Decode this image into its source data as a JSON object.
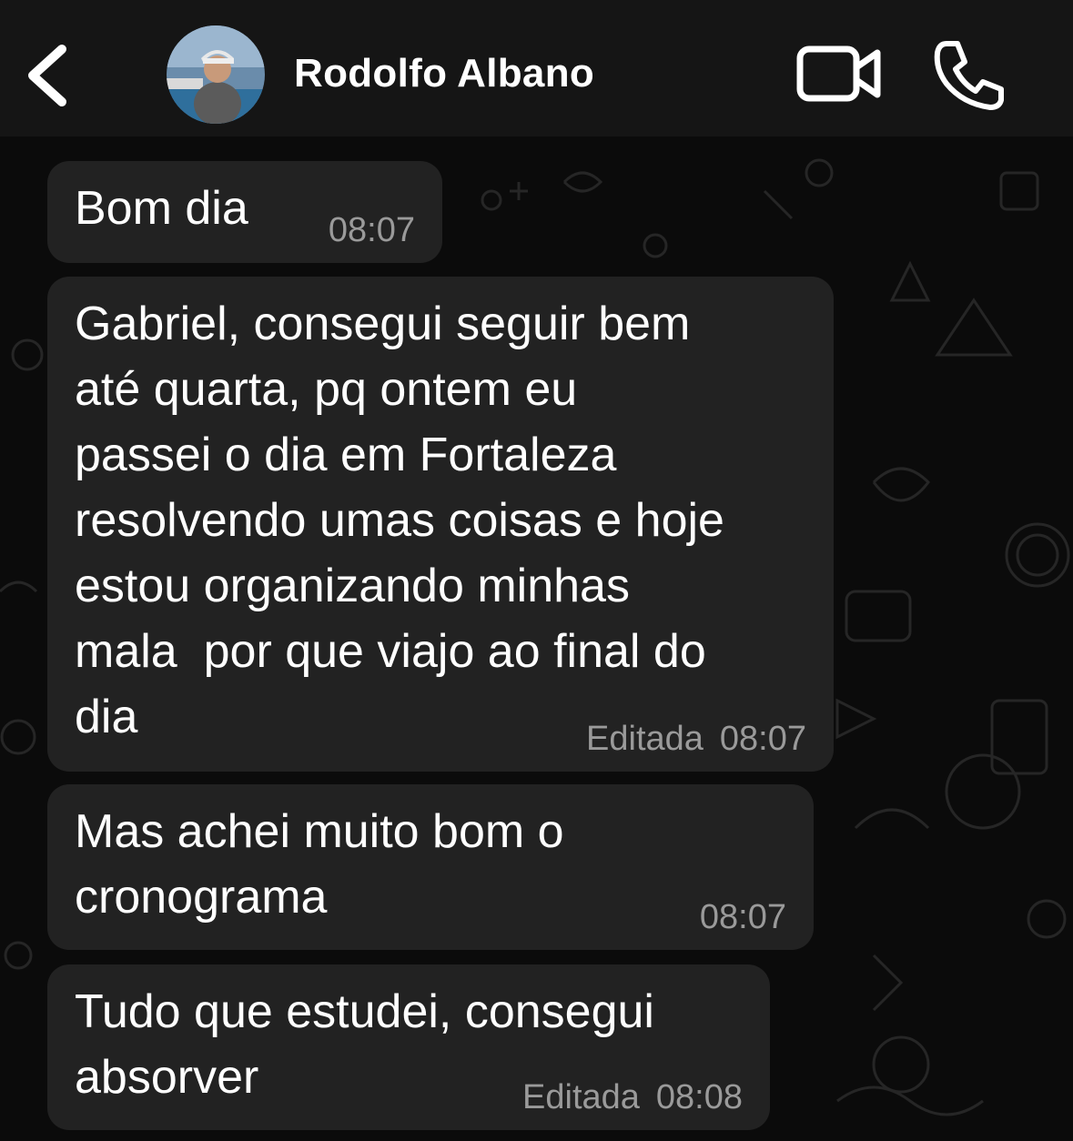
{
  "header": {
    "contact_name": "Rodolfo Albano",
    "icons": {
      "back": "chevron-left-icon",
      "video": "video-camera-icon",
      "call": "phone-icon"
    }
  },
  "colors": {
    "header_bg": "#151515",
    "chat_bg": "#0b0b0b",
    "bubble_bg": "#222222",
    "text": "#ffffff",
    "meta_text": "#9a9a9a"
  },
  "messages": [
    {
      "text": "Bom dia",
      "edited": "",
      "time": "08:07"
    },
    {
      "text": "Gabriel, consegui seguir bem\naté quarta, pq ontem eu\npassei o dia em Fortaleza\nresolvendo umas coisas e hoje\nestou organizando minhas\nmala  por que viajo ao final do\ndia",
      "edited": "Editada",
      "time": "08:07"
    },
    {
      "text": "Mas achei muito bom o\ncronograma",
      "edited": "",
      "time": "08:07"
    },
    {
      "text": "Tudo que estudei, consegui\nabsorver",
      "edited": "Editada",
      "time": "08:08"
    }
  ]
}
